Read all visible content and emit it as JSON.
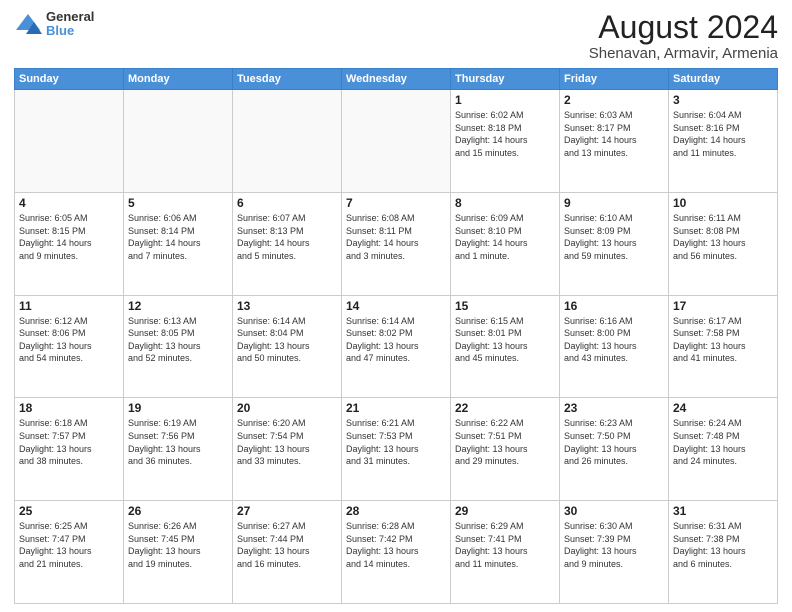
{
  "header": {
    "logo": {
      "line1": "General",
      "line2": "Blue"
    },
    "title": "August 2024",
    "subtitle": "Shenavan, Armavir, Armenia"
  },
  "calendar": {
    "days_of_week": [
      "Sunday",
      "Monday",
      "Tuesday",
      "Wednesday",
      "Thursday",
      "Friday",
      "Saturday"
    ],
    "weeks": [
      [
        {
          "day": "",
          "info": ""
        },
        {
          "day": "",
          "info": ""
        },
        {
          "day": "",
          "info": ""
        },
        {
          "day": "",
          "info": ""
        },
        {
          "day": "1",
          "info": "Sunrise: 6:02 AM\nSunset: 8:18 PM\nDaylight: 14 hours\nand 15 minutes."
        },
        {
          "day": "2",
          "info": "Sunrise: 6:03 AM\nSunset: 8:17 PM\nDaylight: 14 hours\nand 13 minutes."
        },
        {
          "day": "3",
          "info": "Sunrise: 6:04 AM\nSunset: 8:16 PM\nDaylight: 14 hours\nand 11 minutes."
        }
      ],
      [
        {
          "day": "4",
          "info": "Sunrise: 6:05 AM\nSunset: 8:15 PM\nDaylight: 14 hours\nand 9 minutes."
        },
        {
          "day": "5",
          "info": "Sunrise: 6:06 AM\nSunset: 8:14 PM\nDaylight: 14 hours\nand 7 minutes."
        },
        {
          "day": "6",
          "info": "Sunrise: 6:07 AM\nSunset: 8:13 PM\nDaylight: 14 hours\nand 5 minutes."
        },
        {
          "day": "7",
          "info": "Sunrise: 6:08 AM\nSunset: 8:11 PM\nDaylight: 14 hours\nand 3 minutes."
        },
        {
          "day": "8",
          "info": "Sunrise: 6:09 AM\nSunset: 8:10 PM\nDaylight: 14 hours\nand 1 minute."
        },
        {
          "day": "9",
          "info": "Sunrise: 6:10 AM\nSunset: 8:09 PM\nDaylight: 13 hours\nand 59 minutes."
        },
        {
          "day": "10",
          "info": "Sunrise: 6:11 AM\nSunset: 8:08 PM\nDaylight: 13 hours\nand 56 minutes."
        }
      ],
      [
        {
          "day": "11",
          "info": "Sunrise: 6:12 AM\nSunset: 8:06 PM\nDaylight: 13 hours\nand 54 minutes."
        },
        {
          "day": "12",
          "info": "Sunrise: 6:13 AM\nSunset: 8:05 PM\nDaylight: 13 hours\nand 52 minutes."
        },
        {
          "day": "13",
          "info": "Sunrise: 6:14 AM\nSunset: 8:04 PM\nDaylight: 13 hours\nand 50 minutes."
        },
        {
          "day": "14",
          "info": "Sunrise: 6:14 AM\nSunset: 8:02 PM\nDaylight: 13 hours\nand 47 minutes."
        },
        {
          "day": "15",
          "info": "Sunrise: 6:15 AM\nSunset: 8:01 PM\nDaylight: 13 hours\nand 45 minutes."
        },
        {
          "day": "16",
          "info": "Sunrise: 6:16 AM\nSunset: 8:00 PM\nDaylight: 13 hours\nand 43 minutes."
        },
        {
          "day": "17",
          "info": "Sunrise: 6:17 AM\nSunset: 7:58 PM\nDaylight: 13 hours\nand 41 minutes."
        }
      ],
      [
        {
          "day": "18",
          "info": "Sunrise: 6:18 AM\nSunset: 7:57 PM\nDaylight: 13 hours\nand 38 minutes."
        },
        {
          "day": "19",
          "info": "Sunrise: 6:19 AM\nSunset: 7:56 PM\nDaylight: 13 hours\nand 36 minutes."
        },
        {
          "day": "20",
          "info": "Sunrise: 6:20 AM\nSunset: 7:54 PM\nDaylight: 13 hours\nand 33 minutes."
        },
        {
          "day": "21",
          "info": "Sunrise: 6:21 AM\nSunset: 7:53 PM\nDaylight: 13 hours\nand 31 minutes."
        },
        {
          "day": "22",
          "info": "Sunrise: 6:22 AM\nSunset: 7:51 PM\nDaylight: 13 hours\nand 29 minutes."
        },
        {
          "day": "23",
          "info": "Sunrise: 6:23 AM\nSunset: 7:50 PM\nDaylight: 13 hours\nand 26 minutes."
        },
        {
          "day": "24",
          "info": "Sunrise: 6:24 AM\nSunset: 7:48 PM\nDaylight: 13 hours\nand 24 minutes."
        }
      ],
      [
        {
          "day": "25",
          "info": "Sunrise: 6:25 AM\nSunset: 7:47 PM\nDaylight: 13 hours\nand 21 minutes."
        },
        {
          "day": "26",
          "info": "Sunrise: 6:26 AM\nSunset: 7:45 PM\nDaylight: 13 hours\nand 19 minutes."
        },
        {
          "day": "27",
          "info": "Sunrise: 6:27 AM\nSunset: 7:44 PM\nDaylight: 13 hours\nand 16 minutes."
        },
        {
          "day": "28",
          "info": "Sunrise: 6:28 AM\nSunset: 7:42 PM\nDaylight: 13 hours\nand 14 minutes."
        },
        {
          "day": "29",
          "info": "Sunrise: 6:29 AM\nSunset: 7:41 PM\nDaylight: 13 hours\nand 11 minutes."
        },
        {
          "day": "30",
          "info": "Sunrise: 6:30 AM\nSunset: 7:39 PM\nDaylight: 13 hours\nand 9 minutes."
        },
        {
          "day": "31",
          "info": "Sunrise: 6:31 AM\nSunset: 7:38 PM\nDaylight: 13 hours\nand 6 minutes."
        }
      ]
    ]
  }
}
